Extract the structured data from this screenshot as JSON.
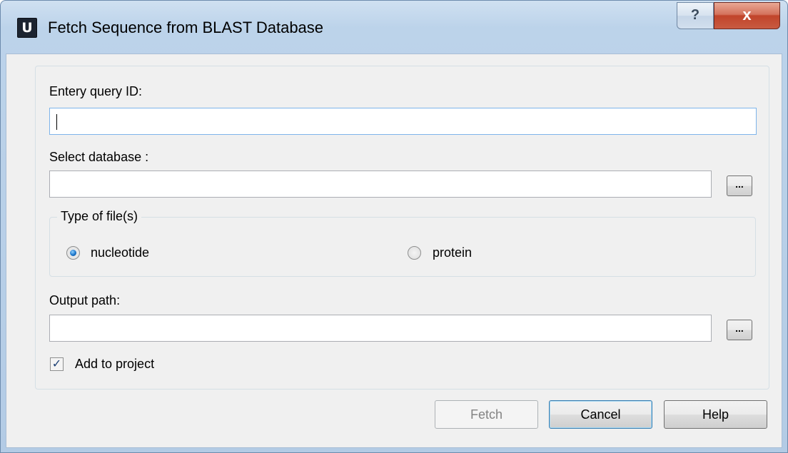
{
  "window": {
    "title": "Fetch Sequence from BLAST Database",
    "app_icon_letter": "U",
    "help_glyph": "?",
    "close_glyph": "x"
  },
  "form": {
    "query_id": {
      "label": "Entery query ID:",
      "value": ""
    },
    "database": {
      "label": "Select database :",
      "value": "",
      "browse_label": "..."
    },
    "file_type": {
      "group_title": "Type of file(s)",
      "options": [
        {
          "label": "nucleotide",
          "selected": true
        },
        {
          "label": "protein",
          "selected": false
        }
      ]
    },
    "output_path": {
      "label": "Output path:",
      "value": "",
      "browse_label": "..."
    },
    "add_to_project": {
      "label": "Add to project",
      "checked": true
    }
  },
  "buttons": {
    "fetch": {
      "label": "Fetch",
      "enabled": false
    },
    "cancel": {
      "label": "Cancel"
    },
    "help": {
      "label": "Help"
    }
  },
  "icons": {
    "app": "app-icon",
    "help": "question-icon",
    "close": "close-icon",
    "checkmark": "checkmark-icon"
  }
}
